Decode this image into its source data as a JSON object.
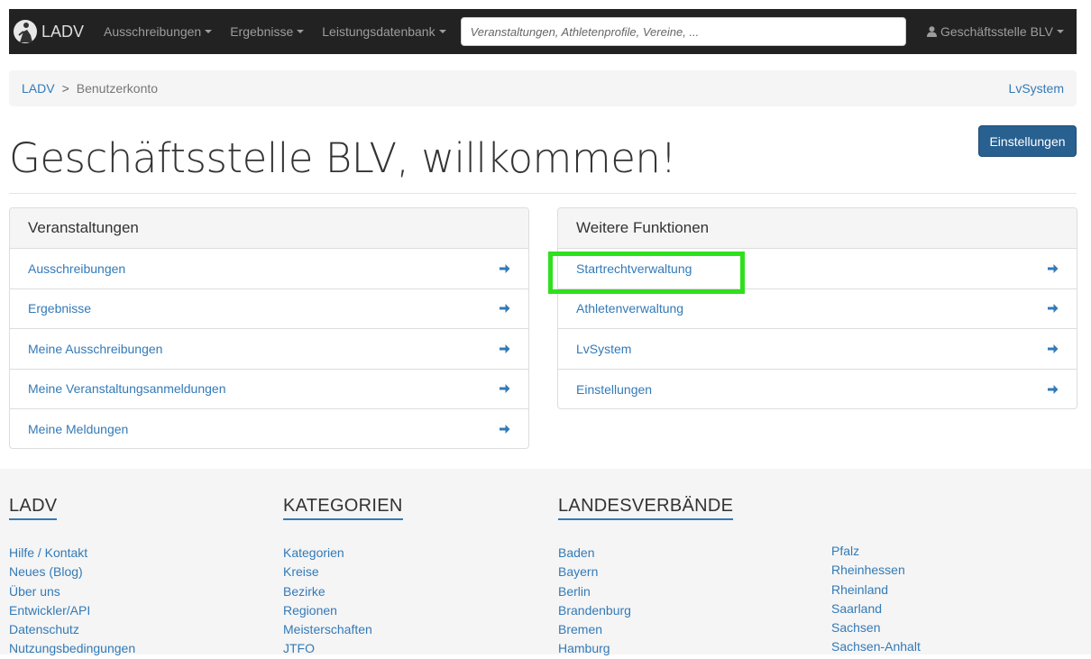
{
  "navbar": {
    "brand": "LADV",
    "menu": [
      {
        "label": "Ausschreibungen"
      },
      {
        "label": "Ergebnisse"
      },
      {
        "label": "Leistungsdatenbank"
      }
    ],
    "search_placeholder": "Veranstaltungen, Athletenprofile, Vereine, ...",
    "user_label": "Geschäftsstelle BLV"
  },
  "breadcrumb": {
    "root": "LADV",
    "separator": ">",
    "current": "Benutzerkonto",
    "right_link": "LvSystem"
  },
  "page": {
    "title": "Geschäftsstelle BLV, willkommen!",
    "settings_button": "Einstellungen"
  },
  "panels": {
    "left": {
      "heading": "Veranstaltungen",
      "items": [
        {
          "label": "Ausschreibungen"
        },
        {
          "label": "Ergebnisse"
        },
        {
          "label": "Meine Ausschreibungen"
        },
        {
          "label": "Meine Veranstaltungsanmeldungen"
        },
        {
          "label": "Meine Meldungen"
        }
      ]
    },
    "right": {
      "heading": "Weitere Funktionen",
      "items": [
        {
          "label": "Startrechtverwaltung"
        },
        {
          "label": "Athletenverwaltung"
        },
        {
          "label": "LvSystem"
        },
        {
          "label": "Einstellungen"
        }
      ]
    }
  },
  "footer": {
    "ladv": {
      "heading": "LADV",
      "links": [
        "Hilfe / Kontakt",
        "Neues (Blog)",
        "Über uns",
        "Entwickler/API",
        "Datenschutz",
        "Nutzungsbedingungen"
      ]
    },
    "kategorien": {
      "heading": "KATEGORIEN",
      "links": [
        "Kategorien",
        "Kreise",
        "Bezirke",
        "Regionen",
        "Meisterschaften",
        "JTFO"
      ]
    },
    "landesverbaende": {
      "heading": "LANDESVERBÄNDE",
      "links_col1": [
        "Baden",
        "Bayern",
        "Berlin",
        "Brandenburg",
        "Bremen",
        "Hamburg"
      ],
      "links_col2": [
        "Pfalz",
        "Rheinhessen",
        "Rheinland",
        "Saarland",
        "Sachsen",
        "Sachsen-Anhalt"
      ]
    }
  },
  "colors": {
    "navbar_bg": "#222222",
    "link": "#337ab7",
    "primary_button": "#286090",
    "highlight": "#2ee01e",
    "footer_bg": "#f5f5f5"
  }
}
